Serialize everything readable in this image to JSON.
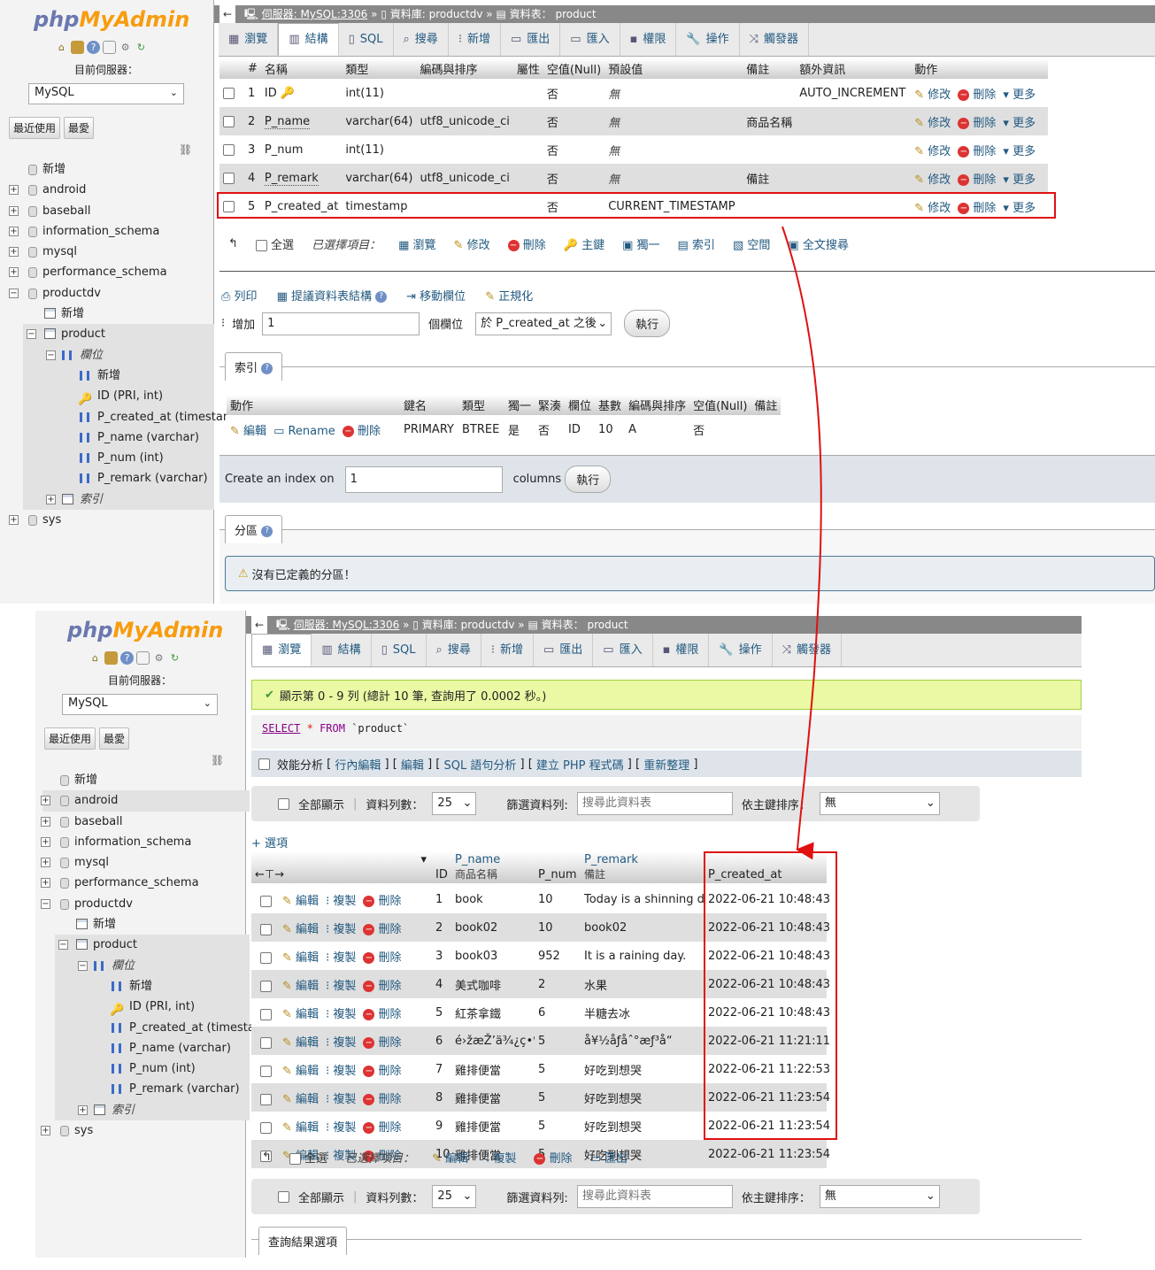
{
  "app": {
    "logo_php": "php",
    "logo_myadmin": "MyAdmin",
    "current_server_label": "目前伺服器：",
    "server_value": "MySQL",
    "recent_btn": "最近使用",
    "favorite_btn": "最愛"
  },
  "tree": {
    "new_label": "新增",
    "databases": [
      "android",
      "baseball",
      "information_schema",
      "mysql",
      "performance_schema",
      "productdv",
      "sys"
    ],
    "db_new": "新增",
    "table_name": "product",
    "columns_label": "欄位",
    "col_new": "新增",
    "columns": [
      "ID (PRI, int)",
      "P_created_at (timestamp)",
      "P_name (varchar)",
      "P_num (int)",
      "P_remark (varchar)"
    ],
    "indexes_label": "索引"
  },
  "breadcrumb": {
    "server": "伺服器: MySQL:3306",
    "database": "資料庫: productdv",
    "table1": "資料表： product",
    "table2": "資料表： product"
  },
  "tabs": [
    "瀏覽",
    "結構",
    "SQL",
    "搜尋",
    "新增",
    "匯出",
    "匯入",
    "權限",
    "操作",
    "觸發器"
  ],
  "structure": {
    "headers": [
      "#",
      "名稱",
      "類型",
      "編碼與排序",
      "屬性",
      "空值(Null)",
      "預設值",
      "備註",
      "額外資訊",
      "動作"
    ],
    "rows": [
      {
        "num": "1",
        "name": "ID",
        "type": "int(11)",
        "collation": "",
        "null": "否",
        "default": "無",
        "comment": "",
        "extra": "AUTO_INCREMENT"
      },
      {
        "num": "2",
        "name": "P_name",
        "type": "varchar(64)",
        "collation": "utf8_unicode_ci",
        "null": "否",
        "default": "無",
        "comment": "商品名稱",
        "extra": ""
      },
      {
        "num": "3",
        "name": "P_num",
        "type": "int(11)",
        "collation": "",
        "null": "否",
        "default": "無",
        "comment": "",
        "extra": ""
      },
      {
        "num": "4",
        "name": "P_remark",
        "type": "varchar(64)",
        "collation": "utf8_unicode_ci",
        "null": "否",
        "default": "無",
        "comment": "備註",
        "extra": ""
      },
      {
        "num": "5",
        "name": "P_created_at",
        "type": "timestamp",
        "collation": "",
        "null": "否",
        "default": "CURRENT_TIMESTAMP",
        "comment": "",
        "extra": ""
      }
    ],
    "row_actions": [
      "修改",
      "刪除",
      "更多"
    ],
    "bulk": {
      "check_all": "全選",
      "selected": "已選擇項目：",
      "browse": "瀏覽",
      "change": "修改",
      "drop": "刪除",
      "primary": "主鍵",
      "unique": "獨一",
      "index": "索引",
      "spatial": "空間",
      "fulltext": "全文搜尋"
    },
    "tools": {
      "print": "列印",
      "propose": "提議資料表結構",
      "move": "移動欄位",
      "normalize": "正規化"
    },
    "add": {
      "label": "增加",
      "count": "1",
      "unit": "個欄位",
      "position": "於 P_created_at 之後",
      "go": "執行"
    }
  },
  "indexes": {
    "legend": "索引",
    "headers": [
      "動作",
      "鍵名",
      "類型",
      "獨一",
      "緊湊",
      "欄位",
      "基數",
      "編碼與排序",
      "空值(Null)",
      "備註"
    ],
    "row": {
      "edit": "編輯",
      "rename": "Rename",
      "drop": "刪除",
      "keyname": "PRIMARY",
      "type": "BTREE",
      "unique": "是",
      "packed": "否",
      "column": "ID",
      "cardinality": "10",
      "collation": "A",
      "null": "否",
      "comment": ""
    },
    "create_label": "Create an index on",
    "create_count": "1",
    "create_unit": "columns",
    "create_go": "執行"
  },
  "partitions": {
    "legend": "分區",
    "message": "沒有已定義的分區！"
  },
  "browse": {
    "success": "顯示第 0 - 9 列 (總計 10 筆, 查詢用了 0.0002 秒。)",
    "sql_select": "SELECT",
    "sql_star": "*",
    "sql_from": "FROM",
    "sql_table": "`product`",
    "links": {
      "profiling": "效能分析",
      "inline": "行內編輯",
      "edit": "編輯",
      "explain": "SQL 語句分析",
      "php": "建立 PHP 程式碼",
      "refresh": "重新整理"
    },
    "filter": {
      "show_all": "全部顯示",
      "rows_label": "資料列數：",
      "rows_value": "25",
      "filter_label": "篩選資料列:",
      "filter_placeholder": "搜尋此資料表",
      "sort_label": "依主鍵排序：",
      "sort_value": "無"
    },
    "options": "+ 選項",
    "col_headers": {
      "id": "ID",
      "pname": "P_name",
      "pname_comment": "商品名稱",
      "pnum": "P_num",
      "premark": "P_remark",
      "premark_comment": "備註",
      "created": "P_created_at"
    },
    "row_actions": {
      "edit": "編輯",
      "copy": "複製",
      "delete": "刪除"
    },
    "rows": [
      {
        "id": "1",
        "name": "book",
        "num": "10",
        "remark": "Today is a shinning day.",
        "created": "2022-06-21 10:48:43"
      },
      {
        "id": "2",
        "name": "book02",
        "num": "10",
        "remark": "book02",
        "created": "2022-06-21 10:48:43"
      },
      {
        "id": "3",
        "name": "book03",
        "num": "952",
        "remark": "It is a raining day.",
        "created": "2022-06-21 10:48:43"
      },
      {
        "id": "4",
        "name": "美式咖啡",
        "num": "2",
        "remark": "水果",
        "created": "2022-06-21 10:48:43"
      },
      {
        "id": "5",
        "name": "紅茶拿鐵",
        "num": "6",
        "remark": "半糖去冰",
        "created": "2022-06-21 10:48:43"
      },
      {
        "id": "6",
        "name": "é›žæŽ’ä¾¿ç•¶",
        "num": "5",
        "remark": "å¥½åƒåˆ°æƒ³å“­",
        "created": "2022-06-21 11:21:11"
      },
      {
        "id": "7",
        "name": "雞排便當",
        "num": "5",
        "remark": "好吃到想哭",
        "created": "2022-06-21 11:22:53"
      },
      {
        "id": "8",
        "name": "雞排便當",
        "num": "5",
        "remark": "好吃到想哭",
        "created": "2022-06-21 11:23:54"
      },
      {
        "id": "9",
        "name": "雞排便當",
        "num": "5",
        "remark": "好吃到想哭",
        "created": "2022-06-21 11:23:54"
      },
      {
        "id": "10",
        "name": "雞排便當",
        "num": "5",
        "remark": "好吃到想哭",
        "created": "2022-06-21 11:23:54"
      }
    ],
    "bulk": {
      "check_all": "全選",
      "selected": "已選擇項目：",
      "edit": "編輯",
      "copy": "複製",
      "delete": "刪除",
      "export": "匯出"
    },
    "query_results": "查詢結果選項"
  },
  "colors": {
    "accent_red": "#e01010",
    "link": "#235a81",
    "success_bg": "#ebf8a4"
  }
}
